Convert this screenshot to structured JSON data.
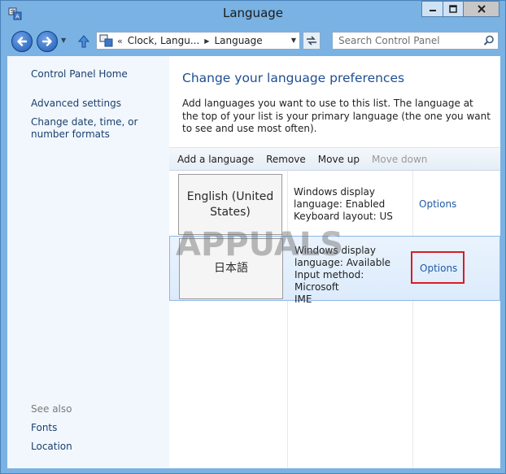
{
  "window": {
    "title": "Language"
  },
  "nav": {
    "breadcrumb_prefix": "«",
    "breadcrumbs": [
      "Clock, Langu...",
      "Language"
    ],
    "search_placeholder": "Search Control Panel"
  },
  "sidebar": {
    "home": "Control Panel Home",
    "advanced": "Advanced settings",
    "datetime": "Change date, time, or number formats",
    "see_also": "See also",
    "fonts": "Fonts",
    "location": "Location"
  },
  "main": {
    "heading": "Change your language preferences",
    "description": "Add languages you want to use to this list. The language at the top of your list is your primary language (the one you want to see and use most often).",
    "toolbar": {
      "add": "Add a language",
      "remove": "Remove",
      "move_up": "Move up",
      "move_down": "Move down"
    },
    "languages": [
      {
        "name": "English (United States)",
        "info": [
          "Windows display",
          "language: Enabled",
          "Keyboard layout: US"
        ],
        "options": "Options",
        "selected": false
      },
      {
        "name": "日本語",
        "info": [
          "Windows display",
          "language: Available",
          "Input method: Microsoft",
          "IME"
        ],
        "options": "Options",
        "selected": true
      }
    ]
  },
  "watermark_text": "APPUALS",
  "colors": {
    "window_frame": "#79b2e3",
    "link": "#1f5aa6",
    "heading": "#1e4e92",
    "highlight": "#d81d24"
  }
}
